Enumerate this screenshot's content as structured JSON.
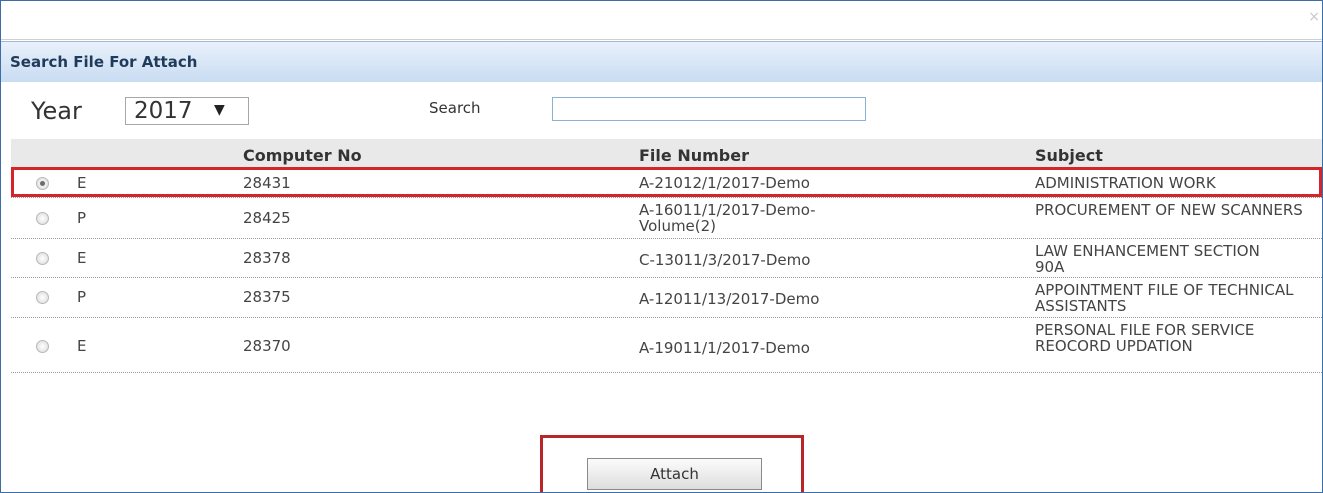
{
  "window": {
    "close_glyph": "×"
  },
  "dialog": {
    "title": "Search File For Attach"
  },
  "filters": {
    "year_label": "Year",
    "year_value": "2017",
    "dropdown_glyph": "▼",
    "search_label": "Search",
    "search_value": ""
  },
  "table": {
    "headers": [
      "Computer No",
      "File Number",
      "Subject"
    ],
    "rows": [
      {
        "selected": true,
        "type": "E",
        "computer_no": "28431",
        "file_number": "A-21012/1/2017-Demo",
        "subject": "ADMINISTRATION WORK"
      },
      {
        "selected": false,
        "type": "P",
        "computer_no": "28425",
        "file_number": "A-16011/1/2017-Demo-Volume(2)",
        "subject": "PROCUREMENT OF NEW SCANNERS"
      },
      {
        "selected": false,
        "type": "E",
        "computer_no": "28378",
        "file_number": "C-13011/3/2017-Demo",
        "subject": "LAW ENHANCEMENT SECTION 90A"
      },
      {
        "selected": false,
        "type": "P",
        "computer_no": "28375",
        "file_number": "A-12011/13/2017-Demo",
        "subject": "APPOINTMENT FILE OF TECHNICAL ASSISTANTS"
      },
      {
        "selected": false,
        "type": "E",
        "computer_no": "28370",
        "file_number": "A-19011/1/2017-Demo",
        "subject": "PERSONAL FILE FOR SERVICE REOCORD UPDATION"
      }
    ]
  },
  "actions": {
    "attach_label": "Attach"
  },
  "colors": {
    "header_gradient_top": "#e9f1fb",
    "header_gradient_bottom": "#c9dcf2",
    "highlight_red": "#d4262a",
    "frame_blue": "#3a6ea5"
  }
}
